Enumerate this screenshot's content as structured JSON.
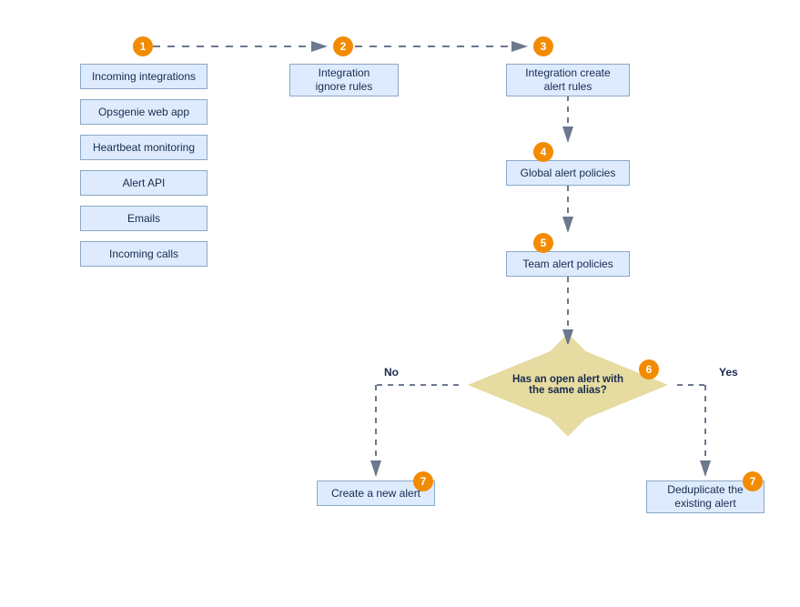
{
  "badges": {
    "b1": "1",
    "b2": "2",
    "b3": "3",
    "b4": "4",
    "b5": "5",
    "b6": "6",
    "b7a": "7",
    "b7b": "7"
  },
  "nodes": {
    "incoming_integrations": "Incoming integrations",
    "opsgenie_web_app": "Opsgenie web app",
    "heartbeat_monitoring": "Heartbeat monitoring",
    "alert_api": "Alert API",
    "emails": "Emails",
    "incoming_calls": "Incoming calls",
    "integration_ignore_rules": "Integration\nignore rules",
    "integration_create_alert_rules": "Integration create\nalert rules",
    "global_alert_policies": "Global alert policies",
    "team_alert_policies": "Team alert policies",
    "create_new_alert": "Create a new alert",
    "deduplicate_existing": "Deduplicate the\nexisting alert"
  },
  "decision": {
    "question": "Has an open alert with\nthe same alias?"
  },
  "labels": {
    "no": "No",
    "yes": "Yes"
  },
  "colors": {
    "node_bg": "#deebff",
    "node_border": "#8ba7c7",
    "badge": "#f38b00",
    "diamond": "#e6dba0",
    "connector": "#6b788e"
  }
}
